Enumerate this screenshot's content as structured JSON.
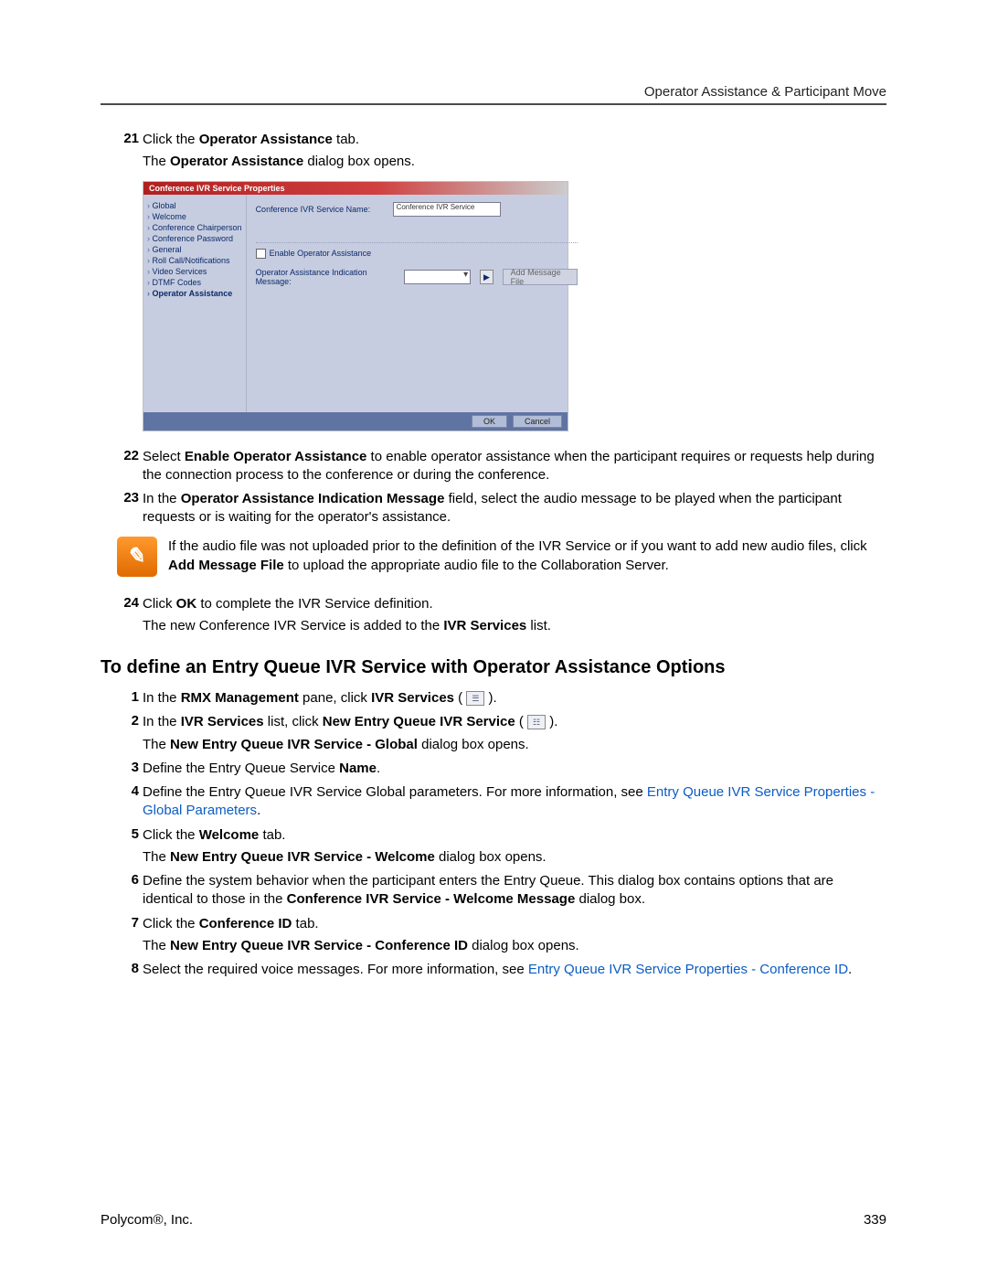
{
  "header": {
    "right": "Operator Assistance & Participant Move"
  },
  "step21": {
    "num": "21",
    "line1_pre": "Click the ",
    "line1_b": "Operator Assistance",
    "line1_post": " tab.",
    "sub_pre": "The ",
    "sub_b": "Operator Assistance",
    "sub_post": " dialog box opens."
  },
  "dialog": {
    "title": "Conference IVR Service Properties",
    "side": {
      "global": "Global",
      "welcome": "Welcome",
      "chair": "Conference Chairperson",
      "pwd": "Conference Password",
      "general": "General",
      "roll": "Roll Call/Notifications",
      "video": "Video Services",
      "dtmf": "DTMF Codes",
      "opasst": "Operator Assistance"
    },
    "name_label": "Conference IVR Service Name:",
    "name_value": "Conference IVR Service",
    "enable_label": "Enable Operator Assistance",
    "msg_label": "Operator Assistance Indication Message:",
    "add_btn": "Add Message File",
    "ok": "OK",
    "cancel": "Cancel"
  },
  "step22": {
    "num": "22",
    "pre": "Select ",
    "b": "Enable Operator Assistance",
    "post": " to enable operator assistance when the participant requires or requests help during the connection process to the conference or during the conference."
  },
  "step23": {
    "num": "23",
    "pre": "In the ",
    "b": "Operator Assistance Indication Message",
    "post": " field, select the audio message to be played when the participant requests or is waiting for the operator's assistance."
  },
  "note": {
    "line1": "If the audio file was not uploaded prior to the definition of the IVR Service or if you want to add new audio files, click ",
    "b": "Add Message File",
    "line1_post": " to upload the appropriate audio file to the Collaboration Server."
  },
  "step24": {
    "num": "24",
    "pre": "Click ",
    "b": "OK",
    "post": " to complete the IVR Service definition.",
    "sub_pre": "The new Conference IVR Service is added to the ",
    "sub_b": "IVR Services",
    "sub_post": " list."
  },
  "section_heading": "To define an Entry Queue IVR Service with Operator Assistance Options",
  "s1": {
    "num": "1",
    "pre": "In the ",
    "b1": "RMX Management",
    "mid": " pane, click ",
    "b2": "IVR Services",
    "post": " ( ",
    "post2": " )."
  },
  "s2": {
    "num": "2",
    "pre": "In the ",
    "b1": "IVR Services",
    "mid": " list, click ",
    "b2": "New Entry Queue IVR Service",
    "post": " ( ",
    "post2": " ).",
    "sub_pre": "The ",
    "sub_b": "New Entry Queue IVR Service - Global",
    "sub_post": " dialog box opens."
  },
  "s3": {
    "num": "3",
    "pre": "Define the Entry Queue Service ",
    "b": "Name",
    "post": "."
  },
  "s4": {
    "num": "4",
    "pre": "Define the Entry Queue IVR Service Global parameters. For more information, see ",
    "link": "Entry Queue IVR Service Properties - Global Parameters",
    "post": "."
  },
  "s5": {
    "num": "5",
    "pre": "Click the ",
    "b": "Welcome",
    "post": " tab.",
    "sub_pre": "The ",
    "sub_b": "New Entry Queue IVR Service - Welcome",
    "sub_post": " dialog box opens."
  },
  "s6": {
    "num": "6",
    "pre": "Define the system behavior when the participant enters the Entry Queue. This dialog box contains options that are identical to those in the ",
    "b": "Conference IVR Service - Welcome Message",
    "post": " dialog box."
  },
  "s7": {
    "num": "7",
    "pre": "Click the ",
    "b": "Conference ID",
    "post": " tab.",
    "sub_pre": "The ",
    "sub_b": "New Entry Queue IVR Service - Conference ID",
    "sub_post": " dialog box opens."
  },
  "s8": {
    "num": "8",
    "pre": "Select the required voice messages. For more information, see ",
    "link": "Entry Queue IVR Service Properties - Conference ID",
    "post": "."
  },
  "footer": {
    "left": "Polycom®, Inc.",
    "right": "339"
  }
}
